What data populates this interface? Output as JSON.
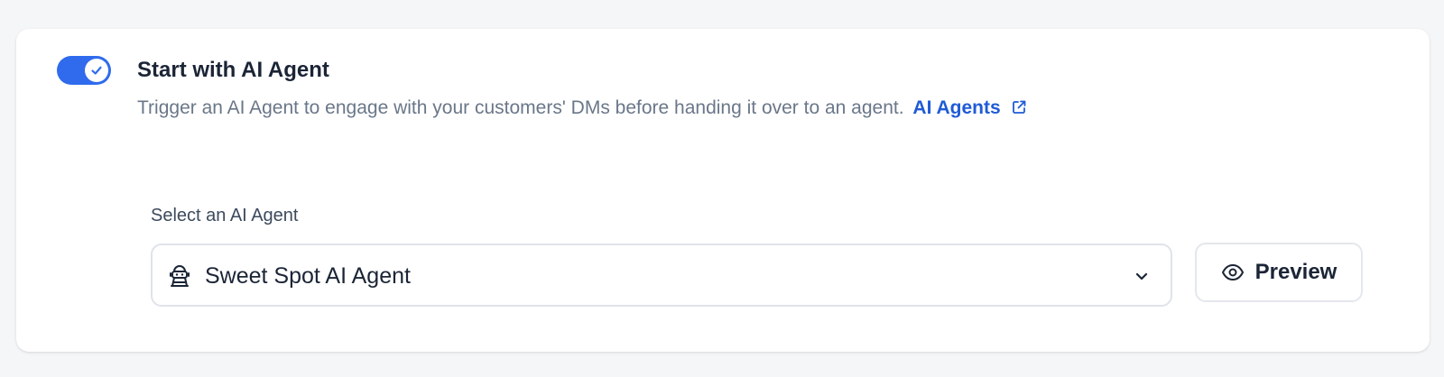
{
  "section": {
    "toggle_on": true,
    "title": "Start with AI Agent",
    "description": "Trigger an AI Agent to engage with your customers' DMs before handing it over to an agent.",
    "link_label": "AI Agents",
    "link_icon": "external-link-icon"
  },
  "agent_select": {
    "label": "Select an AI Agent",
    "selected_value": "Sweet Spot AI Agent",
    "value_icon": "ai-agent-icon",
    "dropdown_icon": "chevron-down-icon"
  },
  "preview_button": {
    "label": "Preview",
    "icon": "eye-icon"
  },
  "colors": {
    "accent": "#2f6bec",
    "link": "#1f5bd6",
    "text_primary": "#1b2536",
    "text_secondary": "#6a7789",
    "background": "#f5f6f8"
  }
}
